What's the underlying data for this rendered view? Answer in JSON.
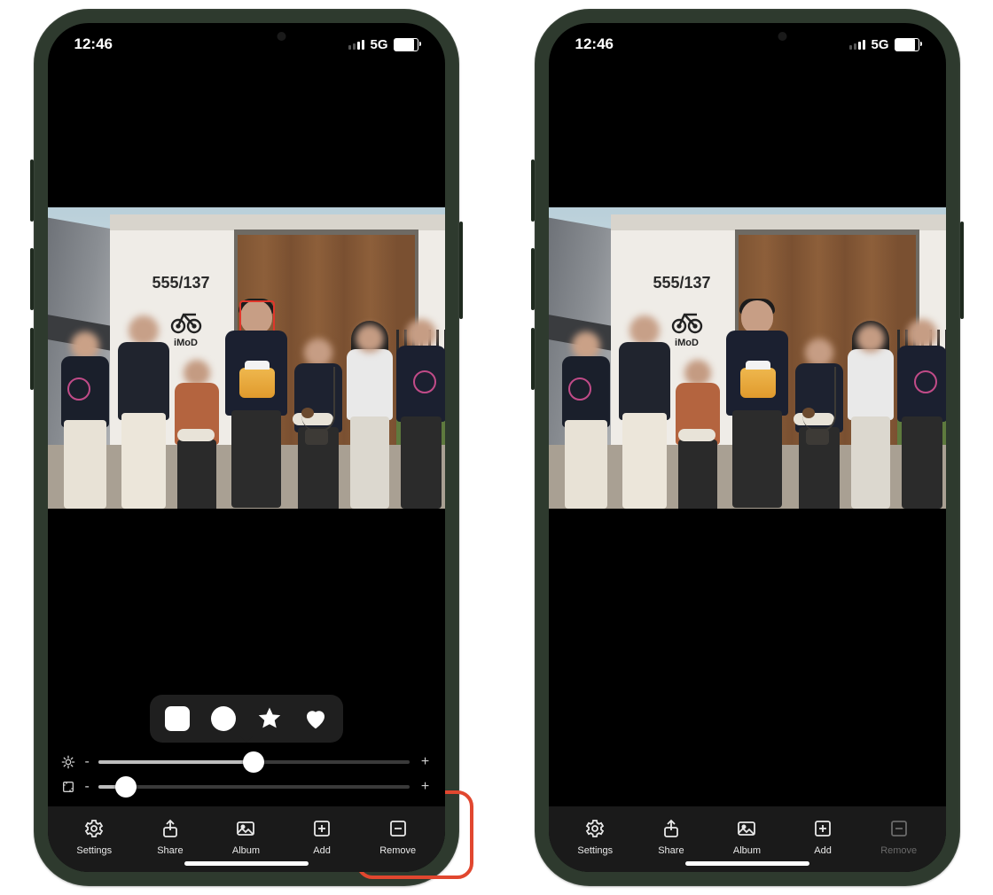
{
  "status": {
    "time": "12:46",
    "network": "5G"
  },
  "photo": {
    "address": "555/137",
    "logo_text": "iMoD"
  },
  "shapes": [
    {
      "name": "square-shape"
    },
    {
      "name": "circle-shape"
    },
    {
      "name": "star-shape"
    },
    {
      "name": "heart-shape"
    }
  ],
  "sliders": {
    "blur": {
      "minus": "-",
      "plus": "+",
      "value_pct": 50
    },
    "size": {
      "minus": "-",
      "plus": "+",
      "value_pct": 9
    }
  },
  "tabs": {
    "settings": "Settings",
    "share": "Share",
    "album": "Album",
    "add": "Add",
    "remove": "Remove"
  },
  "phones": {
    "a": {
      "face_selected": true,
      "remove_dimmed": false
    },
    "b": {
      "face_selected": false,
      "remove_dimmed": true
    }
  },
  "annotation": {
    "highlight_tab": "remove"
  }
}
